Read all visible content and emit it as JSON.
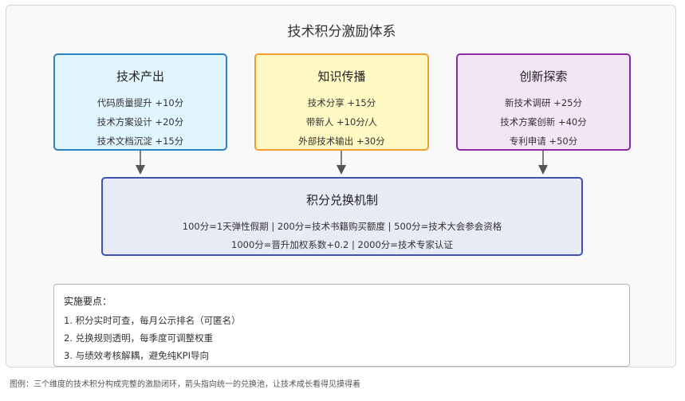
{
  "diagram": {
    "title": "技术积分激励体系",
    "cards": [
      {
        "title": "技术产出",
        "items": [
          "代码质量提升 +10分",
          "技术方案设计 +20分",
          "技术文档沉淀 +15分"
        ],
        "fill": "#e1f5fe",
        "border": "#2a84c4"
      },
      {
        "title": "知识传播",
        "items": [
          "技术分享 +15分",
          "带新人 +10分/人",
          "外部技术输出 +30分"
        ],
        "fill": "#fff9c4",
        "border": "#f39d2b"
      },
      {
        "title": "创新探索",
        "items": [
          "新技术调研 +25分",
          "技术方案创新 +40分",
          "专利申请 +50分"
        ],
        "fill": "#f3e5f5",
        "border": "#8a2ca5"
      }
    ],
    "exchange": {
      "title": "积分兑换机制",
      "lines": [
        "100分=1天弹性假期 | 200分=技术书籍购买额度 | 500分=技术大会参会资格",
        "1000分=晋升加权系数+0.2 | 2000分=技术专家认证"
      ],
      "fill": "#e8eaf6",
      "border": "#3f51b5"
    },
    "arrow_color": "#555555"
  },
  "notes": {
    "title": "实施要点：",
    "items": [
      "1. 积分实时可查，每月公示排名（可匿名）",
      "2. 兑换规则透明，每季度可调整权重",
      "3. 与绩效考核解耦，避免纯KPI导向"
    ]
  },
  "caption": "图例：三个维度的技术积分构成完整的激励闭环，箭头指向统一的兑换池，让技术成长看得见摸得着"
}
